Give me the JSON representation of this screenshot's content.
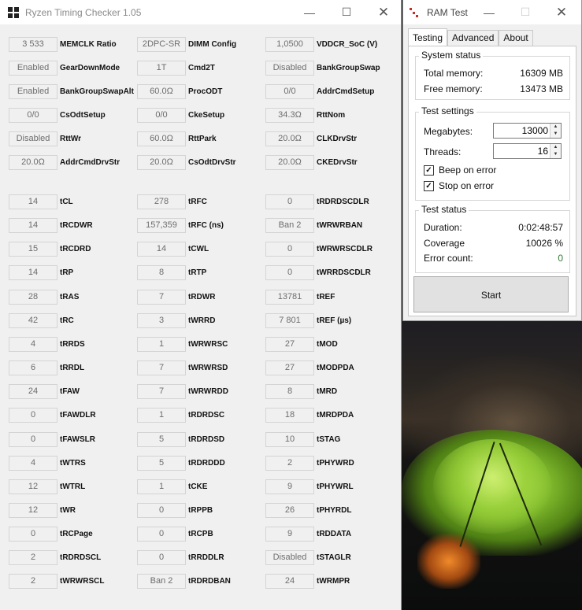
{
  "ryzen": {
    "title": "Ryzen Timing Checker 1.05",
    "rows_top": [
      [
        {
          "v": "3 533",
          "l": "MEMCLK Ratio"
        },
        {
          "v": "2DPC-SR",
          "l": "DIMM Config"
        },
        {
          "v": "1,0500",
          "l": "VDDCR_SoC (V)"
        }
      ],
      [
        {
          "v": "Enabled",
          "l": "GearDownMode"
        },
        {
          "v": "1T",
          "l": "Cmd2T"
        },
        {
          "v": "Disabled",
          "l": "BankGroupSwap"
        }
      ],
      [
        {
          "v": "Enabled",
          "l": "BankGroupSwapAlt"
        },
        {
          "v": "60.0Ω",
          "l": "ProcODT"
        },
        {
          "v": "0/0",
          "l": "AddrCmdSetup"
        }
      ],
      [
        {
          "v": "0/0",
          "l": "CsOdtSetup"
        },
        {
          "v": "0/0",
          "l": "CkeSetup"
        },
        {
          "v": "34.3Ω",
          "l": "RttNom"
        }
      ],
      [
        {
          "v": "Disabled",
          "l": "RttWr"
        },
        {
          "v": "60.0Ω",
          "l": "RttPark"
        },
        {
          "v": "20.0Ω",
          "l": "CLKDrvStr"
        }
      ],
      [
        {
          "v": "20.0Ω",
          "l": "AddrCmdDrvStr"
        },
        {
          "v": "20.0Ω",
          "l": "CsOdtDrvStr"
        },
        {
          "v": "20.0Ω",
          "l": "CKEDrvStr"
        }
      ]
    ],
    "rows_timings": [
      [
        {
          "v": "14",
          "l": "tCL"
        },
        {
          "v": "278",
          "l": "tRFC"
        },
        {
          "v": "0",
          "l": "tRDRDSCDLR"
        }
      ],
      [
        {
          "v": "14",
          "l": "tRCDWR"
        },
        {
          "v": "157,359",
          "l": "tRFC (ns)"
        },
        {
          "v": "Ban 2",
          "l": "tWRWRBAN"
        }
      ],
      [
        {
          "v": "15",
          "l": "tRCDRD"
        },
        {
          "v": "14",
          "l": "tCWL"
        },
        {
          "v": "0",
          "l": "tWRWRSCDLR"
        }
      ],
      [
        {
          "v": "14",
          "l": "tRP"
        },
        {
          "v": "8",
          "l": "tRTP"
        },
        {
          "v": "0",
          "l": "tWRRDSCDLR"
        }
      ],
      [
        {
          "v": "28",
          "l": "tRAS"
        },
        {
          "v": "7",
          "l": "tRDWR"
        },
        {
          "v": "13781",
          "l": "tREF"
        }
      ],
      [
        {
          "v": "42",
          "l": "tRC"
        },
        {
          "v": "3",
          "l": "tWRRD"
        },
        {
          "v": "7 801",
          "l": "tREF (µs)"
        }
      ],
      [
        {
          "v": "4",
          "l": "tRRDS"
        },
        {
          "v": "1",
          "l": "tWRWRSC"
        },
        {
          "v": "27",
          "l": "tMOD"
        }
      ],
      [
        {
          "v": "6",
          "l": "tRRDL"
        },
        {
          "v": "7",
          "l": "tWRWRSD"
        },
        {
          "v": "27",
          "l": "tMODPDA"
        }
      ],
      [
        {
          "v": "24",
          "l": "tFAW"
        },
        {
          "v": "7",
          "l": "tWRWRDD"
        },
        {
          "v": "8",
          "l": "tMRD"
        }
      ],
      [
        {
          "v": "0",
          "l": "tFAWDLR"
        },
        {
          "v": "1",
          "l": "tRDRDSC"
        },
        {
          "v": "18",
          "l": "tMRDPDA"
        }
      ],
      [
        {
          "v": "0",
          "l": "tFAWSLR"
        },
        {
          "v": "5",
          "l": "tRDRDSD"
        },
        {
          "v": "10",
          "l": "tSTAG"
        }
      ],
      [
        {
          "v": "4",
          "l": "tWTRS"
        },
        {
          "v": "5",
          "l": "tRDRDDD"
        },
        {
          "v": "2",
          "l": "tPHYWRD"
        }
      ],
      [
        {
          "v": "12",
          "l": "tWTRL"
        },
        {
          "v": "1",
          "l": "tCKE"
        },
        {
          "v": "9",
          "l": "tPHYWRL"
        }
      ],
      [
        {
          "v": "12",
          "l": "tWR"
        },
        {
          "v": "0",
          "l": "tRPPB"
        },
        {
          "v": "26",
          "l": "tPHYRDL"
        }
      ],
      [
        {
          "v": "0",
          "l": "tRCPage"
        },
        {
          "v": "0",
          "l": "tRCPB"
        },
        {
          "v": "9",
          "l": "tRDDATA"
        }
      ],
      [
        {
          "v": "2",
          "l": "tRDRDSCL"
        },
        {
          "v": "0",
          "l": "tRRDDLR"
        },
        {
          "v": "Disabled",
          "l": "tSTAGLR"
        }
      ],
      [
        {
          "v": "2",
          "l": "tWRWRSCL"
        },
        {
          "v": "Ban 2",
          "l": "tRDRDBAN"
        },
        {
          "v": "24",
          "l": "tWRMPR"
        }
      ]
    ]
  },
  "ramtest": {
    "title": "RAM Test",
    "tabs": [
      "Testing",
      "Advanced",
      "About"
    ],
    "system_status": {
      "title": "System status",
      "total_label": "Total memory:",
      "total_value": "16309 MB",
      "free_label": "Free memory:",
      "free_value": "13473 MB"
    },
    "settings": {
      "title": "Test settings",
      "mb_label": "Megabytes:",
      "mb_value": "13000",
      "threads_label": "Threads:",
      "threads_value": "16",
      "beep_label": "Beep on error",
      "beep_checked": true,
      "stop_label": "Stop on error",
      "stop_checked": true
    },
    "status": {
      "title": "Test status",
      "duration_label": "Duration:",
      "duration_value": "0:02:48:57",
      "coverage_label": "Coverage",
      "coverage_value": "10026 %",
      "errors_label": "Error count:",
      "errors_value": "0"
    },
    "start_label": "Start"
  },
  "colors": {
    "error_count_ok": "#2e7d32",
    "ram_icon": "#c4302b"
  }
}
